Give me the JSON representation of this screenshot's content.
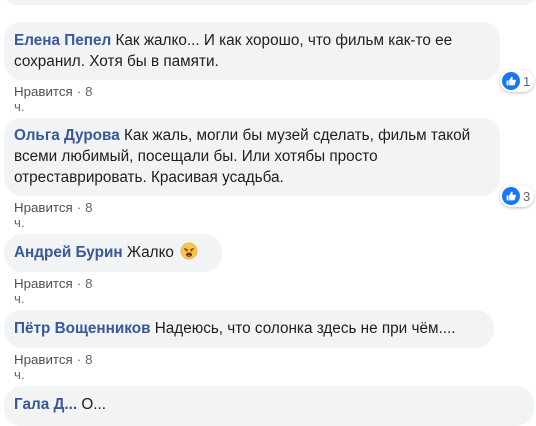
{
  "comments": [
    {
      "author": "Елена Пепел",
      "text_lines": [
        "Как жалко... И как хорошо, что фильм как-то ее",
        "сохранил. Хотя бы в памяти."
      ],
      "like_label": "Нравится",
      "time": "8 ч.",
      "reactions_count": "1"
    },
    {
      "author": "Ольга Дурова",
      "text_lines": [
        "Как жаль, могли бы музей сделать, фильм такой",
        "всеми любимый, посещали бы. Или хотябы просто",
        "отреставрировать. Красивая усадьба."
      ],
      "like_label": "Нравится",
      "time": "8 ч.",
      "reactions_count": "3"
    },
    {
      "author": "Андрей Бурин",
      "text": "Жалко",
      "emoji": "weary-face-icon",
      "like_label": "Нравится",
      "time": "8 ч."
    },
    {
      "author": "Пётр Вощенников",
      "text": "Надеюсь, что солонка здесь не при чём....",
      "like_label": "Нравится",
      "time": "8 ч."
    },
    {
      "author": "Гала Д...",
      "text": "О..."
    }
  ],
  "colors": {
    "author": "#385898",
    "bubble": "#f2f3f5",
    "like_icon": "#1877f2",
    "meta": "#606770"
  }
}
